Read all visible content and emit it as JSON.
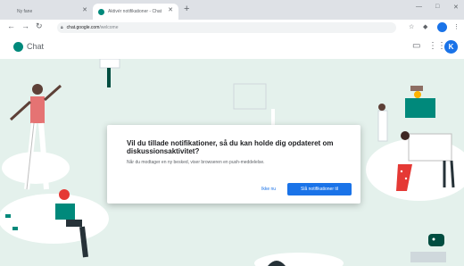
{
  "browser": {
    "tabs": [
      {
        "title": "Ny fane",
        "active": false
      },
      {
        "title": "Aktivér notifikationer - Chat",
        "active": true
      }
    ],
    "address": {
      "host": "chat.google.com",
      "path": "/welcome"
    }
  },
  "header": {
    "app_name": "Chat",
    "avatar_initial": "K"
  },
  "dialog": {
    "title": "Vil du tillade notifikationer, så du kan holde dig opdateret om diskussionsaktivitet?",
    "body": "Når du modtager en ny besked, viser browseren en push-meddelelse.",
    "cancel_label": "Ikke nu",
    "confirm_label": "Slå notifikationer til"
  },
  "colors": {
    "accent": "#1a73e8",
    "chat_green": "#00897b",
    "background": "#e4f1ec"
  },
  "icons": [
    "back-icon",
    "forward-icon",
    "reload-icon",
    "lock-icon",
    "star-icon",
    "extension-icon",
    "menu-icon",
    "close-icon",
    "new-tab-icon",
    "minimize-icon",
    "maximize-icon",
    "chat-logo-icon",
    "room-icon",
    "apps-icon"
  ]
}
